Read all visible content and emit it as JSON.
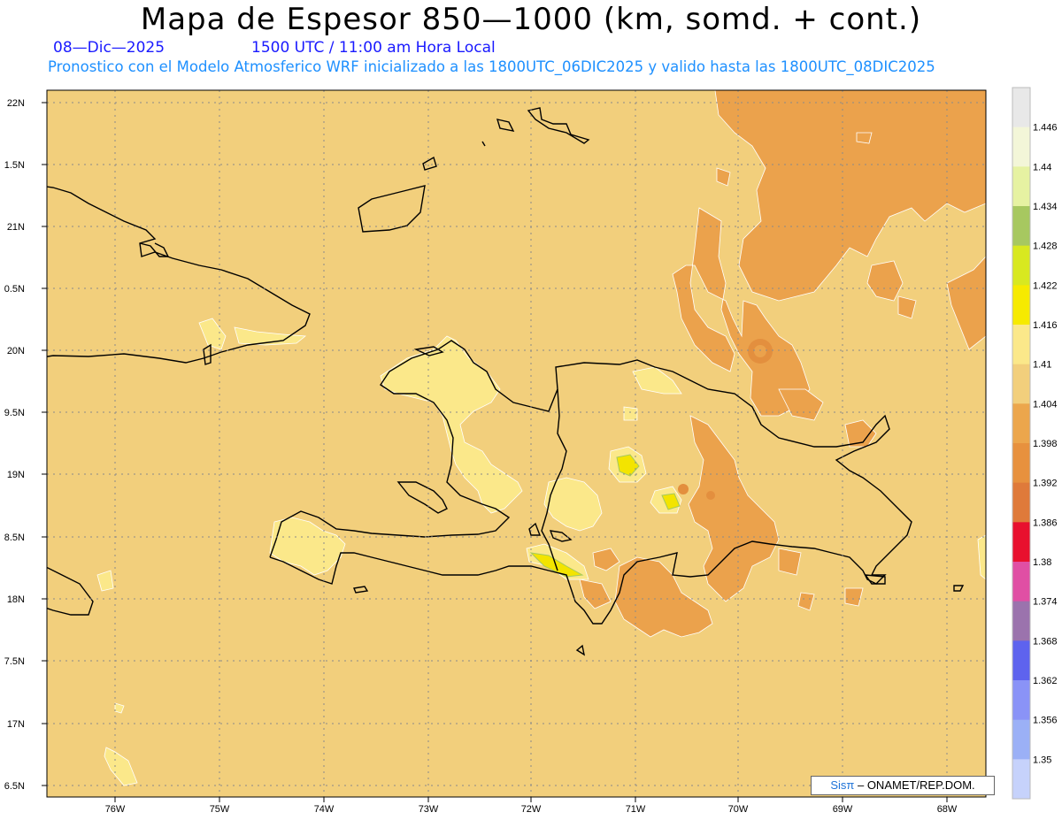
{
  "title": "Mapa de Espesor 850—1000 (km, somd. + cont.)",
  "date": "08—Dic—2025",
  "time": "1500 UTC / 11:00 am Hora Local",
  "forecast": "Pronostico con el Modelo Atmosferico WRF inicializado a las 1800UTC_06DIC2025 y valido hasta las  1800UTC_08DIC2025",
  "credit": {
    "logo": "Sisπ",
    "text": " – ONAMET/REP.DOM."
  },
  "lat_labels": [
    "22N",
    "1.5N",
    "21N",
    "0.5N",
    "20N",
    "9.5N",
    "19N",
    "8.5N",
    "18N",
    "7.5N",
    "17N",
    "6.5N"
  ],
  "lon_labels": [
    "76W",
    "75W",
    "74W",
    "73W",
    "72W",
    "71W",
    "70W",
    "69W",
    "68W"
  ],
  "colorbar": {
    "labels": [
      "1.446",
      "1.44",
      "1.434",
      "1.428",
      "1.422",
      "1.416",
      "1.41",
      "1.404",
      "1.398",
      "1.392",
      "1.386",
      "1.38",
      "1.374",
      "1.368",
      "1.362",
      "1.356",
      "1.35"
    ],
    "colors": [
      "#e8e8e8",
      "#f3f6d8",
      "#e6f2a2",
      "#a7c860",
      "#d8e820",
      "#f6ea00",
      "#fbe88a",
      "#f2cf7c",
      "#eca64c",
      "#e7913e",
      "#df7a3a",
      "#e8102e",
      "#e04fa4",
      "#9b73ad",
      "#5e63ee",
      "#8a93f7",
      "#9bb0f6",
      "#c6d2fb"
    ]
  },
  "colors": {
    "base": "#f2cf7c",
    "orange": "#eba24c",
    "orange_dark": "#e38f3e",
    "yellow": "#fbe88a",
    "yellow_bright": "#f3e400"
  }
}
